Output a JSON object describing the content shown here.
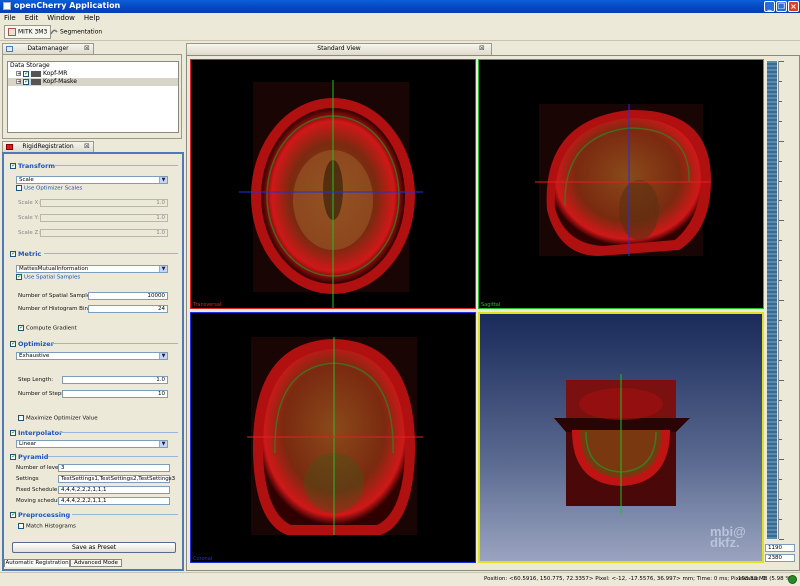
{
  "app": {
    "title": "openCherry Application",
    "colors": {
      "titlebar": "#0346c0",
      "accent": "#1a55c0",
      "transversal": "#e02020",
      "sagittal": "#20c020",
      "coronal": "#2030e0",
      "three_d": "#e0e020"
    }
  },
  "menu": [
    "File",
    "Edit",
    "Window",
    "Help"
  ],
  "toolbar": {
    "btn1_label": "MITK 3M3",
    "btn2_label": "Segmentation"
  },
  "datamanager": {
    "tab_label": "Datamanager",
    "storage_label": "Data Storage",
    "items": [
      {
        "label": "Kopf-MR"
      },
      {
        "label": "Kopf-Maske"
      }
    ]
  },
  "registration": {
    "tab_label": "RigidRegistration",
    "transform": {
      "header": "Transform",
      "type": "Scale",
      "use_optimizer_scales": "Use Optimizer Scales",
      "scale_x_label": "Scale X:",
      "scale_x": "1.0",
      "scale_y_label": "Scale Y:",
      "scale_y": "1.0",
      "scale_z_label": "Scale Z:",
      "scale_z": "1.0"
    },
    "metric": {
      "header": "Metric",
      "type": "MattesMutualInformation",
      "use_spatial_samples": "Use Spatial Samples",
      "spatial_samples_label": "Number of Spatial Samples:",
      "spatial_samples": "10000",
      "histogram_bins_label": "Number of Histogram Bins:",
      "histogram_bins": "24",
      "compute_gradient": "Compute Gradient"
    },
    "optimizer": {
      "header": "Optimizer",
      "type": "Exhaustive",
      "step_length_label": "Step Length:",
      "step_length": "1.0",
      "num_steps_label": "Number of Steps:",
      "num_steps": "10",
      "maximize": "Maximize Optimizer Value"
    },
    "interpolator": {
      "header": "Interpolator",
      "type": "Linear"
    },
    "pyramid": {
      "header": "Pyramid",
      "levels_label": "Number of levels",
      "levels": "3",
      "settings_label": "Settings",
      "settings": "TestSettings1,TestSettings2,TestSettings3",
      "fixed_label": "Fixed Schedule",
      "fixed": "4,4,4,2,2,2,1,1,1",
      "moving_label": "Moving schedule",
      "moving": "4,4,4,2,2,2,1,1,1"
    },
    "preprocessing": {
      "header": "Preprocessing",
      "match_histograms": "Match Histograms"
    },
    "save_preset": "Save as Preset",
    "tabs": [
      "Automatic Registration",
      "Advanced Mode"
    ]
  },
  "standard_view": {
    "tab_label": "Standard View",
    "views": {
      "transversal": "Transversal",
      "sagittal": "Sagittal",
      "coronal": "Coronal"
    },
    "logo_line1": "mbi@",
    "logo_line2": "dkfz."
  },
  "levelwindow": {
    "level": "1190",
    "window": "2380",
    "scale_max": 2380,
    "scale_min": 0,
    "level_fraction": 0.5
  },
  "status": {
    "text": "Position: <60.5916, 150.775, 72.3357> Pixel: <-12, -17.5576, 36.997> mm; Time: 0 ms; Pixelvalue: 0",
    "memory": "198.83 MB (5.98 %)"
  }
}
